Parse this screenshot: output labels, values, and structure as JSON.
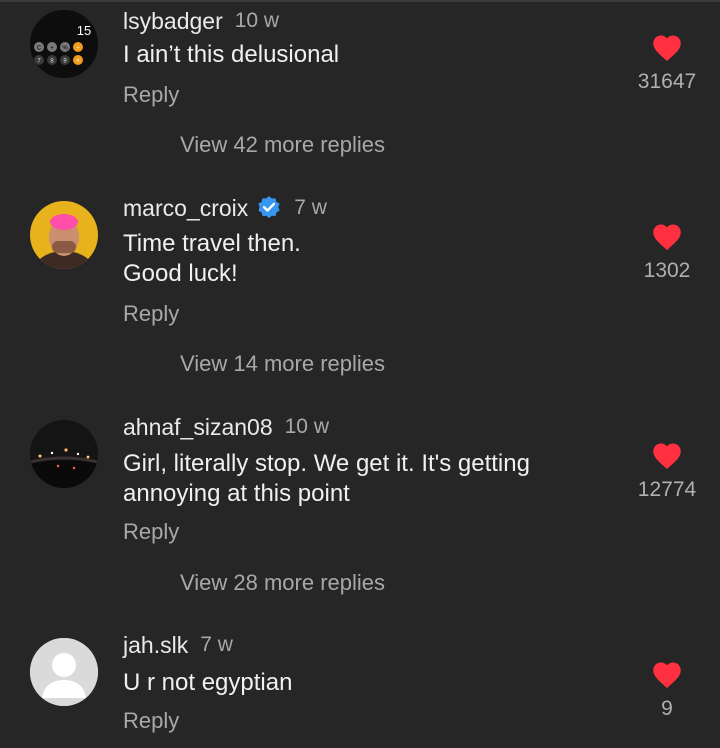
{
  "comments": [
    {
      "username": "lsybadger",
      "time": "10 w",
      "text_lines": [
        "I ain’t this delusional"
      ],
      "reply_label": "Reply",
      "likes": "31647",
      "view_more": "View 42 more replies",
      "avatar_badge": "15",
      "avatar_keys": [
        "C",
        "+",
        "%",
        "÷",
        "7",
        "8",
        "9",
        "×"
      ],
      "verified": false
    },
    {
      "username": "marco_croix",
      "time": "7 w",
      "text_lines": [
        "Time travel then.",
        "Good luck!"
      ],
      "reply_label": "Reply",
      "likes": "1302",
      "view_more": "View 14 more replies",
      "verified": true
    },
    {
      "username": "ahnaf_sizan08",
      "time": "10 w",
      "text_lines": [
        "Girl, literally stop. We get it. It's getting",
        "annoying at this point"
      ],
      "reply_label": "Reply",
      "likes": "12774",
      "view_more": "View 28 more replies",
      "verified": false
    },
    {
      "username": "jah.slk",
      "time": "7 w",
      "text_lines": [
        "U r not egyptian"
      ],
      "reply_label": "Reply",
      "likes": "9",
      "verified": false
    }
  ],
  "colors": {
    "background": "#262626",
    "heart": "#ff3040",
    "verified": "#3797f0"
  },
  "icons": {
    "heart": "heart-icon",
    "verified": "verified-badge-icon"
  }
}
